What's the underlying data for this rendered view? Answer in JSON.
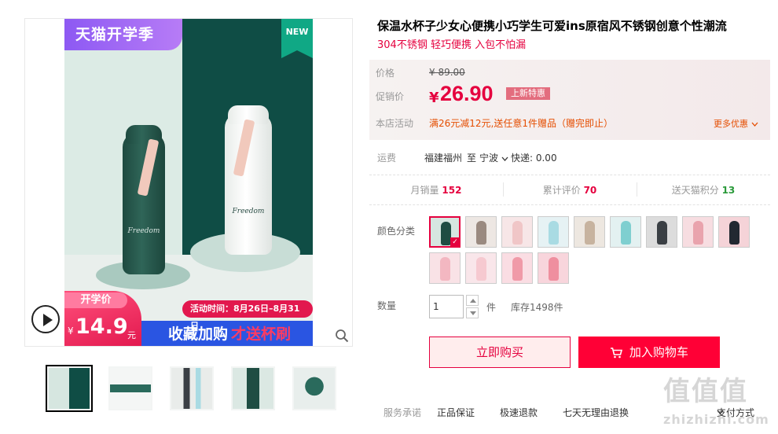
{
  "gallery": {
    "promo_banner_top": "天猫开学季",
    "new_label": "NEW",
    "bottle_brand": "Freedom",
    "promo_price_label": "开学价",
    "promo_price_yen": "¥",
    "promo_price_value": "14.9",
    "promo_price_unit": "元",
    "activity_time": "活动时间：8月26日–8月31日",
    "collect_text": "收藏加购",
    "gift_text": "才送杯刷",
    "thumbnails": [
      {
        "alt": "thumb-1"
      },
      {
        "alt": "thumb-2"
      },
      {
        "alt": "thumb-3"
      },
      {
        "alt": "thumb-4"
      },
      {
        "alt": "thumb-5"
      }
    ]
  },
  "product": {
    "title": "保温水杯子少女心便携小巧学生可爱ins原宿风不锈钢创意个性潮流",
    "subtitle": "304不锈钢 轻巧便携 入包不怕漏"
  },
  "price_panel": {
    "price_label": "价格",
    "original_price": "¥ 89.00",
    "promo_label": "促销价",
    "promo_yen": "¥",
    "promo_price": "26.90",
    "promo_badge": "上新特惠",
    "shop_activity_label": "本店活动",
    "shop_activity_text": "满26元减12元,送任意1件赠品（赠完即止）",
    "more_promo_label": "更多优惠"
  },
  "shipping": {
    "label": "运费",
    "from": "福建福州",
    "to_prefix": "至",
    "to": "宁波",
    "express": "快递: 0.00"
  },
  "stats": {
    "monthly_sales_label": "月销量",
    "monthly_sales_value": "152",
    "reviews_label": "累计评价",
    "reviews_value": "70",
    "points_label": "送天猫积分",
    "points_value": "13"
  },
  "color_options": {
    "label": "颜色分类",
    "swatches": [
      {
        "body_color": "#1f4d43",
        "bg": "#d6e6e0"
      },
      {
        "body_color": "#9a8a80",
        "bg": "#ede7e3"
      },
      {
        "body_color": "#f0c6c7",
        "bg": "#f7e6e7"
      },
      {
        "body_color": "#a9dbe3",
        "bg": "#e6f2f4"
      },
      {
        "body_color": "#c7b39f",
        "bg": "#ede7e0"
      },
      {
        "body_color": "#7fcfd0",
        "bg": "#e3f1f1"
      },
      {
        "body_color": "#3a3f44",
        "bg": "#dcdcdc"
      },
      {
        "body_color": "#e9a3ad",
        "bg": "#f7dde1"
      },
      {
        "body_color": "#222831",
        "bg": "#f5d3d8"
      },
      {
        "body_color": "#f3b7c1",
        "bg": "#f9e2e6"
      },
      {
        "body_color": "#f6c9d0",
        "bg": "#f9e6ea"
      },
      {
        "body_color": "#f09aa8",
        "bg": "#fadde3"
      },
      {
        "body_color": "#ef8f9f",
        "bg": "#f8d5dc"
      }
    ],
    "selected_index": 0
  },
  "quantity": {
    "label": "数量",
    "value": "1",
    "unit": "件",
    "stock": "库存1498件"
  },
  "actions": {
    "buy_now": "立即购买",
    "add_to_cart": "加入购物车"
  },
  "service": {
    "label": "服务承诺",
    "items": [
      "正品保证",
      "极速退款",
      "七天无理由退换"
    ],
    "payment": "支付方式"
  },
  "watermark": {
    "logo": "值值值",
    "site": "zhizhizhi.com"
  },
  "colors": {
    "accent": "#e5003e",
    "cart_button": "#ff0036",
    "promo_purple": "#8d59f3",
    "promo_blue": "#2a55e2"
  }
}
